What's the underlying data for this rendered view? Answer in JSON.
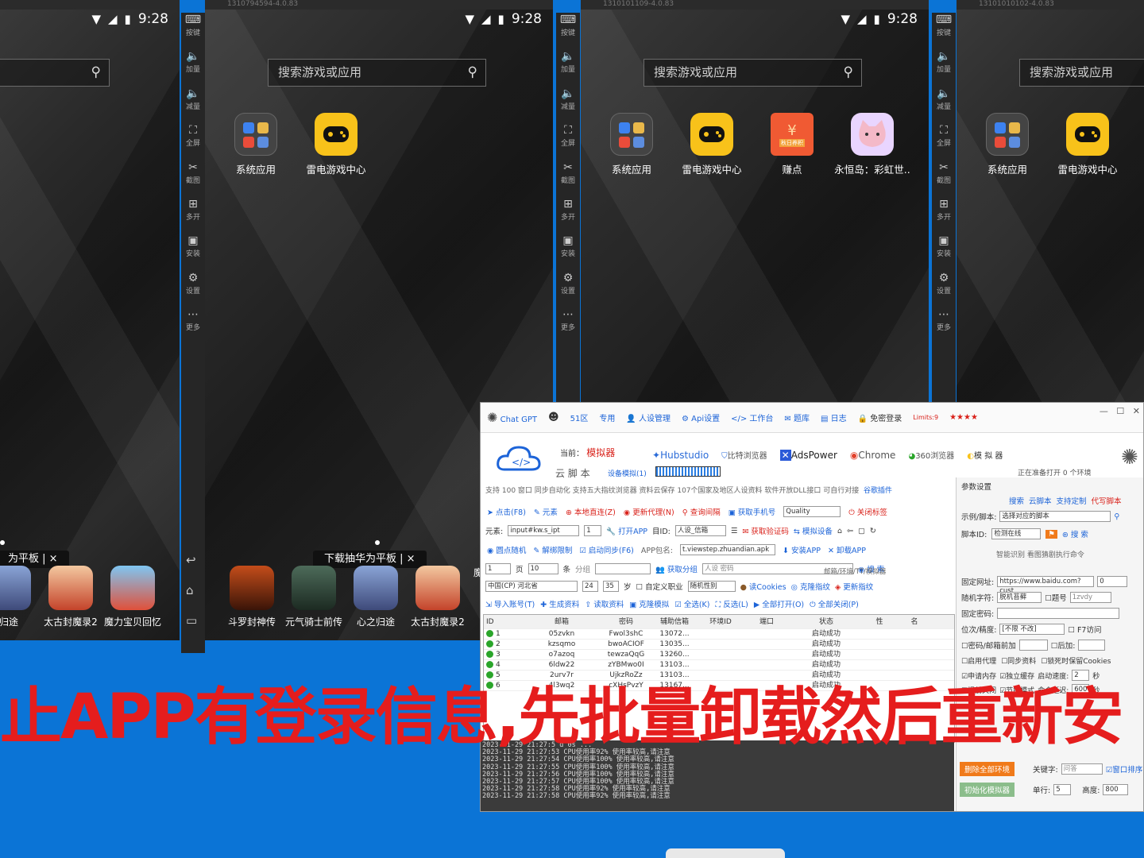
{
  "status_time": "9:28",
  "search_placeholder": "搜索游戏或应用",
  "emulator_titles": [
    "1310794594-4.0.83",
    "1310101109-4.0.83",
    "13101010102-4.0.83"
  ],
  "apps": {
    "system": "系统应用",
    "game_center": "雷电游戏中心",
    "coin": "赚点",
    "coin_badge": "秋日养积",
    "cat": "永恒岛：彩虹世.."
  },
  "sidebar": [
    "按键",
    "加量",
    "减量",
    "全屏",
    "截图",
    "多开",
    "安装",
    "设置",
    "更多"
  ],
  "dock_left": [
    "归途",
    "太古封魔录2",
    "魔力宝贝回忆"
  ],
  "dock_right": [
    "斗罗封神传",
    "元气骑士前传",
    "心之归途",
    "太古封魔录2",
    "魔"
  ],
  "pill_left": "为平板 | ×",
  "pill_right": "下载抽华为平板 | ×",
  "banner_text": "止APP有登录信息,先批量卸载然后重新安",
  "tool": {
    "menu": [
      "Chat GPT",
      "51区",
      "专用",
      "人设管理",
      "Api设置",
      "工作台",
      "题库",
      "日志",
      "免密登录"
    ],
    "limit": "Limits:9",
    "brand_label": "当前：",
    "brand_value": "模拟器",
    "brand_sub": "云 脚 本",
    "brand_progress": "设备模拟(1)",
    "browsers": [
      "Hubstudio",
      "比特浏览器",
      "AdsPower",
      "Chrome",
      "360浏览器",
      "模 拟 器"
    ],
    "opening": "正在准备打开 0 个环境",
    "support_line": "支持 100 窗口  同步自动化  支持五大指纹浏览器  资料云保存  107个国家及地区人设资料  软件开放DLL接口  可自行对接",
    "plugin_link": "谷歌插件",
    "r1": [
      "点击(F8)",
      "元素",
      "本地直连(Z)",
      "更新代理(N)",
      "查询间隔",
      "获取手机号",
      "Quality",
      "关闭标签"
    ],
    "r2_label": "元素:",
    "r2_input": "input#kw.s_ipt",
    "r2_num": "1",
    "r2": [
      "打开APP",
      "目ID:",
      "人设_信箱",
      "获取验证码",
      "模拟设备",
      "",
      ""
    ],
    "r3": [
      "圆点随机",
      "解绑限制",
      "启动同步(F6)",
      "APP包名:",
      "t.viewstep.zhuandian.apk",
      "安装APP",
      "卸载APP"
    ],
    "r4": [
      "1",
      "页",
      "10",
      "条",
      "分组",
      "",
      "获取分组",
      "人设 密码",
      "邮箱/环境/TT/模拟器",
      "搜 索"
    ],
    "r5": [
      "中国(CP) 河北省",
      "24",
      "35",
      "岁",
      "自定义职业",
      "随机性别",
      "读Cookies",
      "克隆指纹",
      "更新指纹"
    ],
    "r6": [
      "导入账号(T)",
      "生成资料",
      "读取资料",
      "克隆模拟",
      "全选(K)",
      "反选(L)",
      "全部打开(O)",
      "全部关闭(P)"
    ],
    "table_head": [
      "ID",
      "邮箱",
      "密码",
      "辅助信箱",
      "环境ID",
      "端口",
      "状态",
      "性",
      "名"
    ],
    "rows": [
      [
        "1",
        "05zvkn",
        "Fwol3shC",
        "13072...",
        "",
        "",
        "启动成功",
        "",
        ""
      ],
      [
        "2",
        "kzsqmo",
        "bwoACIOF",
        "13035...",
        "",
        "",
        "启动成功",
        "",
        ""
      ],
      [
        "3",
        "o7azoq",
        "tewzaQqG",
        "13260...",
        "",
        "",
        "启动成功",
        "",
        ""
      ],
      [
        "4",
        "6ldw22",
        "zYBMwo0I",
        "13103...",
        "",
        "",
        "启动成功",
        "",
        ""
      ],
      [
        "5",
        "2urv7r",
        "UjkzRoZz",
        "13103...",
        "",
        "",
        "启动成功",
        "",
        ""
      ],
      [
        "6",
        "4l3wq2",
        "cXHsPvzY",
        "13167...",
        "",
        "",
        "启动成功",
        "",
        ""
      ]
    ],
    "logs": [
      "2023-11-29 21:27:5    d 0s  ...",
      "2023-11-29 21:27:53  CPU使用率92% 使用率较高,请注意",
      "2023-11-29 21:27:54  CPU使用率100% 使用率较高,请注意",
      "2023-11-29 21:27:55  CPU使用率100% 使用率较高,请注意",
      "2023-11-29 21:27:56  CPU使用率100% 使用率较高,请注意",
      "2023-11-29 21:27:57  CPU使用率100% 使用率较高,请注意",
      "2023-11-29 21:27:58  CPU使用率92% 使用率较高,请注意",
      "2023-11-29 21:27:58  CPU使用率92% 使用率较高,请注意"
    ],
    "right": {
      "title": "参数设置",
      "links": [
        "搜索",
        "云脚本",
        "支持定制",
        "代写脚本"
      ],
      "example_label": "示例/脚本:",
      "example_value": "选择对应的脚本",
      "script_label": "脚本ID:",
      "script_value": "检测在线",
      "search_btn": "搜 索",
      "hint": "智能识别  看图猜剧执行命令",
      "url_label": "固定网址:",
      "url_value": "https://www.baidu.com?cust",
      "url_num": "0",
      "rand_label": "随机字符:",
      "rand_select": "脱机苔藓",
      "rand_check": "题号",
      "rand_value": "1zvdy",
      "pwd_label": "固定密码:",
      "loc_label": "位次/精度:",
      "loc_select": "[不限 不改]",
      "chk1": "密码/邮箱前加",
      "chk1b": "后加:",
      "chk2": [
        "启用代理",
        "同步资料",
        "锁死时保留Cookies"
      ],
      "chk3": [
        "申请内存",
        "独立缓存",
        "启动速度:",
        "2",
        "秒"
      ],
      "chk4": [
        "提前关闭",
        "节能模式",
        "命令延迟:",
        "600",
        "秒"
      ],
      "keyword_label": "关键字:",
      "keyword_value": "问答",
      "window_sort": "窗口排序",
      "delete_btn": "删除全部环境",
      "init_btn": "初始化模拟器",
      "col_label": "单行:",
      "col_value": "5",
      "height_label": "高度:",
      "height_value": "800"
    }
  }
}
